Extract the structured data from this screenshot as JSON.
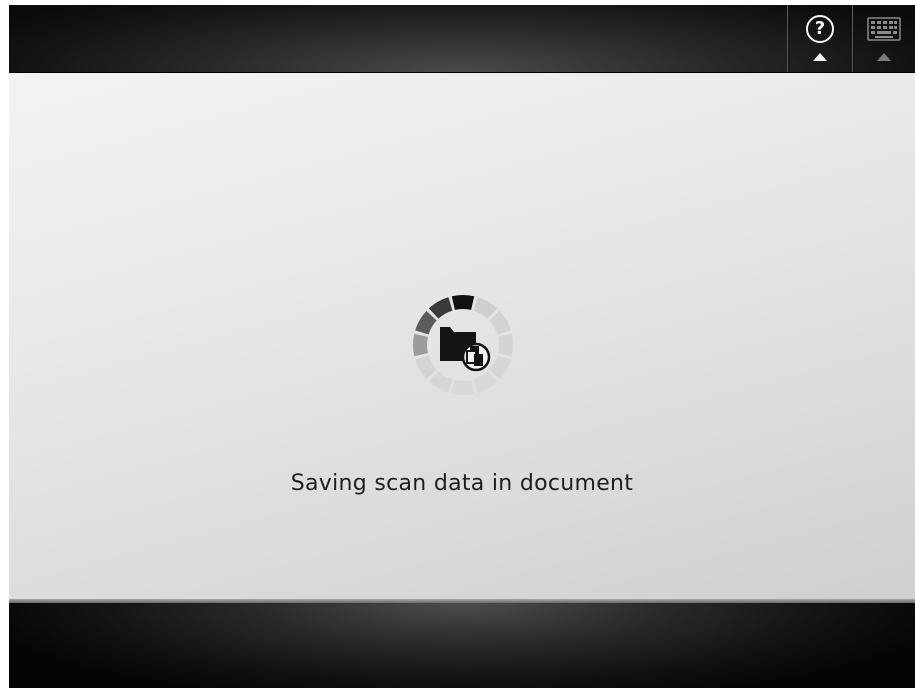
{
  "header": {
    "help_icon": "help-question-icon",
    "keyboard_icon": "keyboard-icon"
  },
  "main": {
    "progress_icon": "saving-to-folder-spinner-icon",
    "status_text": "Saving scan data in document"
  },
  "colors": {
    "bar_dark": "#1a1a1a",
    "main_background": "#e6e6e6",
    "spinner_active": "#222222",
    "spinner_inactive": "#cfcfcf",
    "text": "#1e1e1e"
  }
}
